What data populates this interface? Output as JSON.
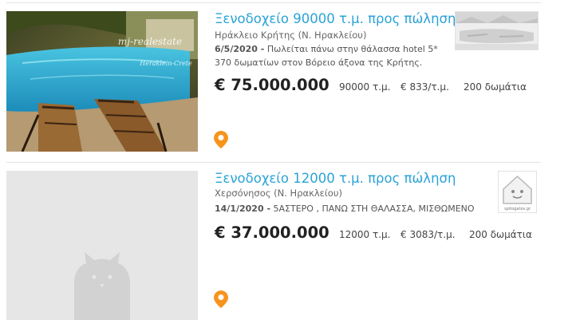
{
  "listings": [
    {
      "title": "Ξενοδοχείο 90000 τ.μ. προς πώληση",
      "location": "Ηράκλειο Κρήτης (Ν. Ηρακλείου)",
      "date": "6/5/2020 -",
      "description": "Πωλείται πάνω στην θάλασσα hotel 5* 370 δωματίων στον Βόρειο άξονα της Κρήτης.",
      "price": "€ 75.000.000",
      "area": "90000 τ.μ.",
      "price_per_sqm": "€ 833/τ.μ.",
      "rooms": "200 δωμάτια",
      "watermark_line1": "mj-realestate",
      "watermark_line2": "Heraklein-Crete"
    },
    {
      "title": "Ξενοδοχείο 12000 τ.μ. προς πώληση",
      "location": "Χερσόνησος (Ν. Ηρακλείου)",
      "date": "14/1/2020 -",
      "description": "5ΑΣΤΕΡΟ , ΠΑΝΩ ΣΤΗ ΘΑΛΑΣΣΑ, ΜΙΣΘΩΜΕΝΟ",
      "price": "€ 37.000.000",
      "area": "12000 τ.μ.",
      "price_per_sqm": "€ 3083/τ.μ.",
      "rooms": "200 δωμάτια",
      "agency_logo_text": "spitogatos.gr"
    }
  ],
  "icons": {
    "map_pin": "map-pin-icon",
    "no_photo": "cat-placeholder-icon",
    "agency_logo": "house-mascot-icon"
  },
  "colors": {
    "title": "#2aa3d6",
    "pin": "#f7941d",
    "price": "#222222",
    "placeholder": "#e6e6e6"
  }
}
